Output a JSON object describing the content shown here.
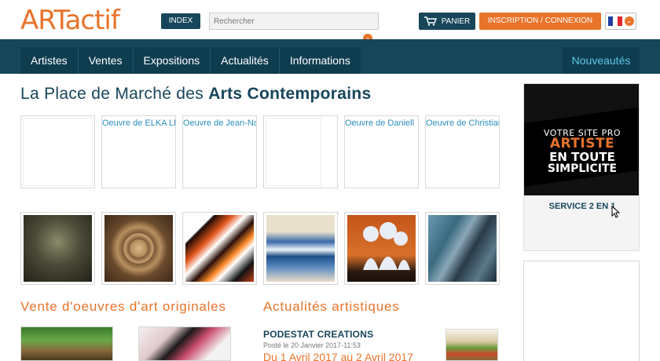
{
  "header": {
    "logo_art": "ART",
    "logo_actif": "actif",
    "index_label": "INDEX",
    "search_placeholder": "Rechercher",
    "search_go_icon": "chevron-right-icon",
    "cart_label": "PANIER",
    "login_label": "INSCRIPTION / CONNEXION",
    "language": "FR"
  },
  "nav": {
    "items": [
      "Artistes",
      "Ventes",
      "Expositions",
      "Actualités",
      "Informations"
    ],
    "new_label": "Nouveautés"
  },
  "main": {
    "title_prefix": "La Place de Marché des ",
    "title_bold": "Arts Contemporains",
    "row1_captions": [
      "",
      "Oeuvre de ELKA LEO",
      "Oeuvre de Jean-Noël",
      "",
      "Oeuvre de Daniell",
      "Oeuvre de Christian"
    ],
    "section_sales": "Vente d'oeuvres d'art originales",
    "section_news": "Actualités artistiques",
    "news": {
      "title": "PODESTAT CREATIONS",
      "date": "Posté le 20 Janvier 2017-11:53",
      "event": "Du 1 Avril 2017 au 2 Avril 2017"
    }
  },
  "sidebar": {
    "ad_line1": "VOTRE SITE PRO",
    "ad_line2": "ARTISTE",
    "ad_line3": "EN TOUTE",
    "ad_line4": "SIMPLICITE",
    "ad_service": "SERVICE 2 EN 1"
  },
  "colors": {
    "brand_orange": "#e8732a",
    "brand_navy": "#17465a",
    "accent_cyan": "#5cc7e8"
  }
}
